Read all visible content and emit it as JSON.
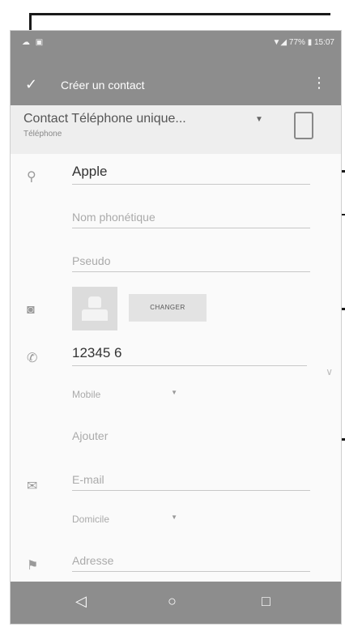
{
  "status": {
    "left_icons": "☁ ▣",
    "right": "▼◢ 77% ▮ 15:07"
  },
  "appbar": {
    "title": "Créer un contact",
    "check_icon": "check-icon",
    "more_icon": "more-vert-icon"
  },
  "account": {
    "name": "Contact Téléphone unique...",
    "type": "Téléphone",
    "arrow": "▼"
  },
  "form": {
    "name_value": "Apple",
    "phonetic_placeholder": "Nom phonétique",
    "nickname_placeholder": "Pseudo",
    "change_label": "CHANGER",
    "phone_value": "12345 6",
    "phone_type": "Mobile",
    "add_label": "Ajouter",
    "email_placeholder": "E-mail",
    "email_type": "Domicile",
    "address_placeholder": "Adresse"
  },
  "nav": {
    "back": "◁",
    "home": "○",
    "recent": "□"
  }
}
